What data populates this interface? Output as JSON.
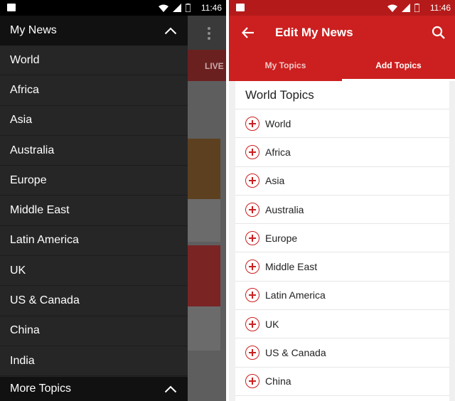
{
  "status_bar": {
    "time": "11:46"
  },
  "left_screen": {
    "behind": {
      "live_tab_label": "LIVE"
    },
    "drawer": {
      "title": "My News",
      "items": [
        {
          "label": "World"
        },
        {
          "label": "Africa"
        },
        {
          "label": "Asia"
        },
        {
          "label": "Australia"
        },
        {
          "label": "Europe"
        },
        {
          "label": "Middle East"
        },
        {
          "label": "Latin America"
        },
        {
          "label": "UK"
        },
        {
          "label": "US & Canada"
        },
        {
          "label": "China"
        },
        {
          "label": "India"
        }
      ],
      "footer_label": "More Topics"
    }
  },
  "right_screen": {
    "app_bar": {
      "title": "Edit My News"
    },
    "tabs": [
      {
        "label": "My Topics",
        "active": false
      },
      {
        "label": "Add Topics",
        "active": true
      }
    ],
    "section_title": "World Topics",
    "topics": [
      {
        "label": "World"
      },
      {
        "label": "Africa"
      },
      {
        "label": "Asia"
      },
      {
        "label": "Australia"
      },
      {
        "label": "Europe"
      },
      {
        "label": "Middle East"
      },
      {
        "label": "Latin America"
      },
      {
        "label": "UK"
      },
      {
        "label": "US & Canada"
      },
      {
        "label": "China"
      }
    ]
  },
  "colors": {
    "brand_red": "#cc1f1f",
    "drawer_bg": "#262626",
    "drawer_header_bg": "#111111"
  },
  "icons": [
    "image-icon",
    "wifi-icon",
    "signal-icon",
    "battery-icon",
    "kebab-menu-icon",
    "chevron-up-icon",
    "back-arrow-icon",
    "search-icon",
    "add-circle-icon"
  ]
}
